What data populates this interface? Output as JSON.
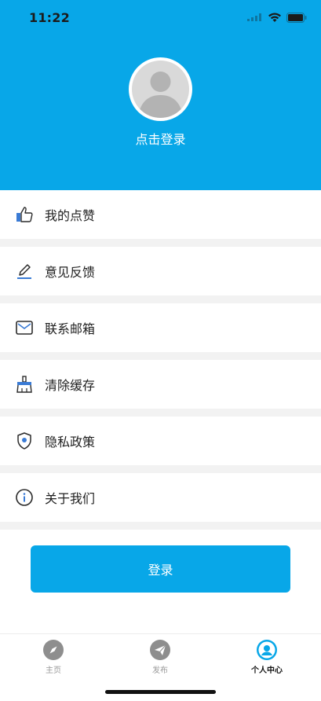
{
  "status_bar": {
    "time": "11:22"
  },
  "profile": {
    "login_prompt": "点击登录"
  },
  "menu": {
    "items": [
      {
        "label": "我的点赞",
        "icon": "thumbs-up-icon"
      },
      {
        "label": "意见反馈",
        "icon": "pencil-icon"
      },
      {
        "label": "联系邮箱",
        "icon": "mail-icon"
      },
      {
        "label": "清除缓存",
        "icon": "broom-icon"
      },
      {
        "label": "隐私政策",
        "icon": "shield-icon"
      },
      {
        "label": "关于我们",
        "icon": "info-icon"
      }
    ]
  },
  "login_button": {
    "label": "登录"
  },
  "tabbar": {
    "tabs": [
      {
        "label": "主页",
        "icon": "compass-icon",
        "active": false
      },
      {
        "label": "发布",
        "icon": "paper-plane-icon",
        "active": false
      },
      {
        "label": "个人中心",
        "icon": "user-circle-icon",
        "active": true
      }
    ]
  },
  "colors": {
    "accent": "#08a7e8",
    "divider": "#f2f2f2",
    "inactive": "#9a9a9a"
  }
}
